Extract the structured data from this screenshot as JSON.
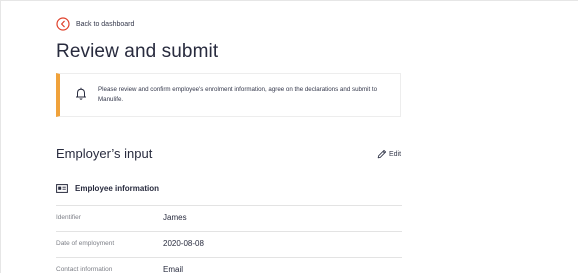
{
  "back_link": {
    "label": "Back to dashboard"
  },
  "page_title": "Review and submit",
  "notice": {
    "text": "Please review and confirm employee's enrolment information, agree on the declarations and submit to Manulife.",
    "accent_color": "#f0a23b"
  },
  "employer_section": {
    "title": "Employer’s input",
    "edit_label": "Edit"
  },
  "employee_info": {
    "title": "Employee information",
    "rows": [
      {
        "label": "Identifier",
        "value": "James"
      },
      {
        "label": "Date of employment",
        "value": "2020-08-08"
      },
      {
        "label": "Contact information",
        "value": "Email"
      }
    ]
  },
  "icons": {
    "back": "chevron-left-circle-icon",
    "notice": "bell-icon",
    "edit": "pencil-icon",
    "section": "id-card-icon"
  },
  "colors": {
    "accent_red": "#e0402a",
    "accent_orange": "#f0a23b",
    "text": "#282b3e"
  }
}
